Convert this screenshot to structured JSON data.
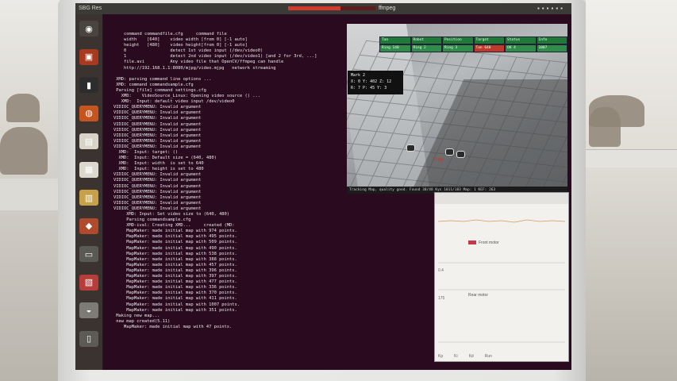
{
  "topbar": {
    "title": "SBG Res",
    "process": "ffmpeg",
    "icons": [
      "keyboard-icon",
      "mail-icon",
      "network-icon",
      "volume-icon",
      "clock-icon",
      "gear-icon"
    ],
    "progress": 0.6
  },
  "launcher": {
    "items": [
      {
        "name": "dash-icon",
        "glyph": "◉",
        "color": "#4a4440"
      },
      {
        "name": "files-icon",
        "glyph": "▣",
        "color": "#a73a1f"
      },
      {
        "name": "terminal-icon",
        "glyph": "▮",
        "color": "#2d2d2d"
      },
      {
        "name": "browser-icon",
        "glyph": "◍",
        "color": "#c6541e"
      },
      {
        "name": "document-icon",
        "glyph": "▤",
        "color": "#d8d3c9"
      },
      {
        "name": "spreadsheet-icon",
        "glyph": "▦",
        "color": "#ddd8cf"
      },
      {
        "name": "presentation-icon",
        "glyph": "▥",
        "color": "#c7a04a"
      },
      {
        "name": "software-center-icon",
        "glyph": "◆",
        "color": "#b04a2c"
      },
      {
        "name": "window-icon",
        "glyph": "▭",
        "color": "#5b5956"
      },
      {
        "name": "image-viewer-icon",
        "glyph": "▧",
        "color": "#b63d3a"
      },
      {
        "name": "disk-icon",
        "glyph": "◒",
        "color": "#7e7b76"
      },
      {
        "name": "trash-icon",
        "glyph": "▯",
        "color": "#5e5a56"
      }
    ]
  },
  "terminal": {
    "lines": [
      "    command commandfile.cfg     command file",
      "    width    [640]    video width [from 0] [-1 auto]",
      "    height   [480]    video height[from 0] [-1 auto]",
      "    0                 detect 1st video input (/dev/video0)",
      "    1                 detect 2nd video input (/dev/video1) [and 2 for 3rd, ...]",
      "    file.avi          Any video file that OpenCV/ffmpeg can handle",
      "    http://192.168.1.1:8080/mjpg/video.mjpg   network streaming",
      "",
      " XMD: parsing command line options ...",
      " XMD: command commandsample.cfg",
      " Parsing [file] command settings.cfg",
      "   XMD:    VideoSource_Linux: Opening video source () ...",
      "   XMD:  Input: default video input /dev/video0",
      "VIDIOC_QUERYMENU: Invalid argument",
      "VIDIOC_QUERYMENU: Invalid argument",
      "VIDIOC_QUERYMENU: Invalid argument",
      "VIDIOC_QUERYMENU: Invalid argument",
      "VIDIOC_QUERYMENU: Invalid argument",
      "VIDIOC_QUERYMENU: Invalid argument",
      "VIDIOC_QUERYMENU: Invalid argument",
      "VIDIOC_QUERYMENU: Invalid argument",
      "  XMD:  Input: target: ()",
      "  XMD:  Input: Default size = (640, 480)",
      "  XMD:  Input: width  is set to 640",
      "  XMD:  Input: height is set to 480",
      "VIDIOC_QUERYMENU: Invalid argument",
      "VIDIOC_QUERYMENU: Invalid argument",
      "VIDIOC_QUERYMENU: Invalid argument",
      "VIDIOC_QUERYMENU: Invalid argument",
      "VIDIOC_QUERYMENU: Invalid argument",
      "VIDIOC_QUERYMENU: Invalid argument",
      "VIDIOC_QUERYMENU: Invalid argument",
      "     XMD: Input: Set video size to (640, 480)",
      "     Parsing commandsample.cfg",
      "     XMD-ival: Creating XMD...     created (MD:",
      "     MapMaker: made initial map with 974 points.",
      "     MapMaker: made initial map with 495 points.",
      "     MapMaker: made initial map with 509 points.",
      "     MapMaker: made initial map with 490 points.",
      "     MapMaker: made initial map with 538 points.",
      "     MapMaker: made initial map with 388 points.",
      "     MapMaker: made initial map with 457 points.",
      "     MapMaker: made initial map with 396 points.",
      "     MapMaker: made initial map with 397 points.",
      "     MapMaker: made initial map with 477 points.",
      "     MapMaker: made initial map with 336 points.",
      "     MapMaker: made initial map with 370 points.",
      "     MapMaker: made initial map with 411 points.",
      "     MapMaker: made initial map with 1007 points.",
      "     MapMaker: made initial map with 351 points.",
      " Making new map...",
      " new map created(5.11)",
      "    MapMaker: made initial map with 47 points."
    ]
  },
  "camera": {
    "overlay_lines": [
      "Mark 2",
      "X: 0  Y: 402  Z: 12",
      "R: 7  P: 45  Y: 3"
    ],
    "robot_label": "Tray",
    "status": "Tracking Map, quality good. Found 38/48 Kys 1011/183 Map: 1 KEF: 263",
    "table_rows": [
      [
        "Tan",
        "Robot",
        "Position",
        "Target",
        "Status",
        "Info"
      ],
      [
        "Ring 140",
        "Ring 2",
        "Ring 3",
        "Tan 640",
        "OK 4",
        "1007"
      ]
    ],
    "colors": {
      "row0": "#1f7a3a",
      "row1": "#2f8c4a",
      "alert": "#c0392b"
    }
  },
  "plot": {
    "legend1": "Front motor",
    "legend2": "Rear motor",
    "label1": "0.4",
    "label2": "175",
    "footer": [
      "Kp",
      "Ki",
      "Kd",
      "Run"
    ]
  }
}
